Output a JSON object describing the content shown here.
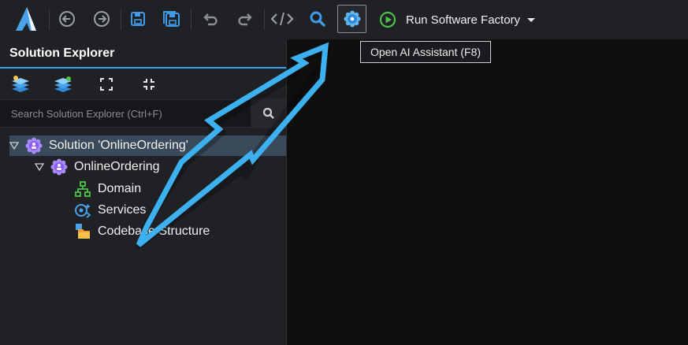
{
  "toolbar": {
    "run_label": "Run Software Factory",
    "icons": [
      "logo",
      "back",
      "forward",
      "save",
      "save-all",
      "undo",
      "redo",
      "code",
      "search",
      "ai-assistant",
      "run",
      "dropdown"
    ],
    "accent_color": "#37a6e6"
  },
  "tooltip": {
    "text": "Open AI Assistant (F8)"
  },
  "solution_explorer": {
    "title": "Solution Explorer",
    "search_placeholder": "Search Solution Explorer (Ctrl+F)",
    "tree": [
      {
        "label": "Solution 'OnlineOrdering'",
        "level": 0,
        "expanded": true,
        "selected": true
      },
      {
        "label": "OnlineOrdering",
        "level": 1,
        "expanded": true
      },
      {
        "label": "Domain",
        "level": 2
      },
      {
        "label": "Services",
        "level": 2
      },
      {
        "label": "Codebase Structure",
        "level": 2
      }
    ]
  }
}
